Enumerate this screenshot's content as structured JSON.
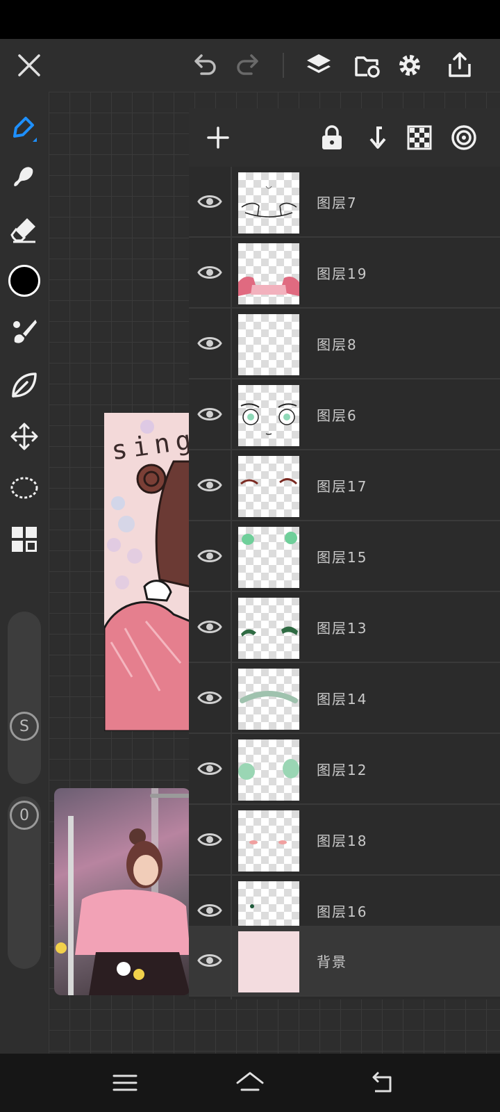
{
  "top_bar": {
    "icons": [
      "close-icon",
      "undo-icon",
      "redo-icon",
      "layers-icon",
      "import-icon",
      "gear-icon",
      "share-icon"
    ]
  },
  "tools": [
    "pen-icon",
    "smudge-icon",
    "eraser-icon",
    "color-swatch",
    "brush-icon",
    "leaf-icon",
    "move-icon",
    "lasso-icon",
    "grid-icon"
  ],
  "colors": {
    "accent": "#1e90ff",
    "current_color": "#000000",
    "background_layer": "#f3dcdf"
  },
  "sliders": {
    "size_label": "S",
    "opacity_label": "0"
  },
  "artwork": {
    "text": "sing"
  },
  "layers_panel": {
    "toolbar": [
      "add-layer-icon",
      "lock-icon",
      "merge-down-icon",
      "transparency-icon",
      "target-icon"
    ],
    "layers": [
      {
        "name": "图层7"
      },
      {
        "name": "图层19"
      },
      {
        "name": "图层8"
      },
      {
        "name": "图层6"
      },
      {
        "name": "图层17"
      },
      {
        "name": "图层15"
      },
      {
        "name": "图层13"
      },
      {
        "name": "图层14"
      },
      {
        "name": "图层12"
      },
      {
        "name": "图层18"
      },
      {
        "name": "图层16"
      }
    ],
    "background_layer": {
      "name": "背景"
    }
  },
  "nav_bar": [
    "menu-icon",
    "home-icon",
    "back-icon"
  ]
}
